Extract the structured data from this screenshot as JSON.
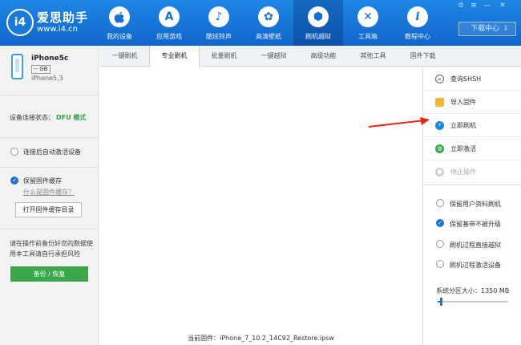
{
  "app": {
    "name": "爱思助手",
    "url": "www.i4.cn"
  },
  "nav": [
    {
      "label": "我的设备",
      "icon": "apple-icon",
      "glyph": ""
    },
    {
      "label": "应用游戏",
      "icon": "app-store-icon",
      "glyph": "A"
    },
    {
      "label": "酷炫铃声",
      "icon": "bell-icon",
      "glyph": "♪"
    },
    {
      "label": "高清壁纸",
      "icon": "flower-icon",
      "glyph": "✿"
    },
    {
      "label": "刷机越狱",
      "icon": "box-icon",
      "glyph": "⬢",
      "active": true
    },
    {
      "label": "工具箱",
      "icon": "tools-icon",
      "glyph": "✕"
    },
    {
      "label": "教程中心",
      "icon": "info-icon",
      "glyph": "i"
    }
  ],
  "window_controls": {
    "shirt": "♔",
    "menu": "≡",
    "minimize": "—",
    "close": "✕"
  },
  "download_center": {
    "label": "下载中心",
    "arrow": "⇩"
  },
  "device": {
    "name": "iPhone5c",
    "capacity": "-- GB",
    "model": "iPhone5,3"
  },
  "status": {
    "label": "设备连接状态：",
    "value": "DFU 模式"
  },
  "auto_activate": {
    "label": "连接后自动激活设备",
    "checked": false
  },
  "cache": {
    "label": "保留固件缓存",
    "checked": true,
    "link": "什么是固件缓存？",
    "button": "打开固件缓存目录"
  },
  "warning": "请在操作前备份好您的数据使用本工具请自行承担风险",
  "backup_button": "备份 / 恢复",
  "tabs": [
    "一键刷机",
    "专业刷机",
    "批量刷机",
    "一键越狱",
    "高级功能",
    "其他工具",
    "固件下载"
  ],
  "active_tab": "专业刷机",
  "current_firmware": {
    "label": "当前固件：",
    "value": "iPhone_7_10.2_14C92_Restore.ipsw"
  },
  "actions": [
    {
      "label": "查询SHSH",
      "icon": "search-icon",
      "glyph": "⌕",
      "color": "#f0f0f0",
      "glyph_color": "#333",
      "enabled": true
    },
    {
      "label": "导入固件",
      "icon": "folder-icon",
      "glyph": "▬",
      "color": "#f2b632",
      "glyph_color": "#f2b632",
      "enabled": true
    },
    {
      "label": "立即刷机",
      "icon": "lightning-icon",
      "glyph": "⚡",
      "color": "#1a8ae0",
      "glyph_color": "#fff",
      "enabled": true
    },
    {
      "label": "立即激活",
      "icon": "globe-icon",
      "glyph": "◍",
      "color": "#36a84a",
      "glyph_color": "#fff",
      "enabled": true
    },
    {
      "label": "停止操作",
      "icon": "stop-icon",
      "glyph": "◉",
      "color": "#cfcfcf",
      "glyph_color": "#fff",
      "enabled": false
    }
  ],
  "options": [
    {
      "label": "保留用户资料刷机",
      "checked": false
    },
    {
      "label": "保留基带不被升级",
      "checked": true
    },
    {
      "label": "刷机过程直接越狱",
      "checked": false
    },
    {
      "label": "刷机过程激活设备",
      "checked": false
    }
  ],
  "partition": {
    "label": "系统分区大小：1350 MB",
    "level": 0.05
  },
  "colors": {
    "header": "#1572d8",
    "accent": "#1a73d3",
    "success": "#3aa84a",
    "status_green": "#2ca44a",
    "annotation": "#e8261b"
  }
}
